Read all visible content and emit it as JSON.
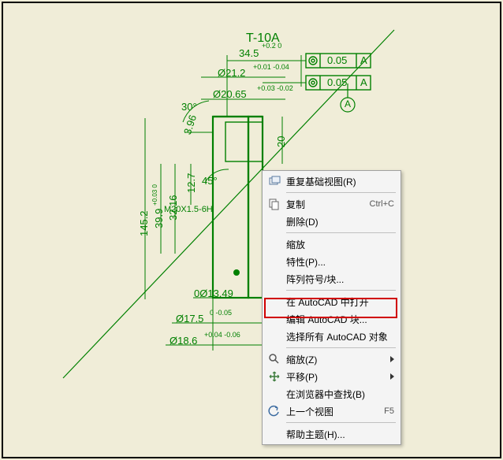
{
  "drawing": {
    "title": "T-10A",
    "dim_34_5": "34.5",
    "tol_34_5": "+0.2\n0",
    "dim_d21_2": "Ø21.2",
    "tol_d21_2": "+0.01\n-0.04",
    "dim_d20_65": "Ø20.65",
    "tol_d20_65": "+0.03\n-0.02",
    "dim_30": "30°",
    "dim_3_96": "3.96",
    "dim_20": "20",
    "dim_12_7": "12.7",
    "dim_32_16": "32.16",
    "dim_145_2": "145.2",
    "dim_39_9": "39.9",
    "tol_39_9": "+0.03\n0",
    "thread": "M20X1.5-6H",
    "dim_45": "45°",
    "dim_0_d13_49": "0Ø13.49",
    "dim_d17_5": "Ø17.5",
    "tol_d17_5": "0\n-0.05",
    "dim_d18_6": "Ø18.6",
    "tol_d18_6": "+0.04\n-0.06",
    "datum_A": "A",
    "gtol_val": "0.05",
    "gtol_ref": "A"
  },
  "menu": {
    "repeat_base": "重复基础视图(R)",
    "copy": "复制",
    "copy_shortcut": "Ctrl+C",
    "delete": "删除(D)",
    "scale": "缩放",
    "properties": "特性(P)...",
    "array_symbols": "阵列符号/块...",
    "open_in_autocad": "在 AutoCAD 中打开",
    "edit_autocad_block": "编辑 AutoCAD 块...",
    "select_all_autocad": "选择所有 AutoCAD 对象",
    "zoom": "缩放(Z)",
    "pan": "平移(P)",
    "find_in_browser": "在浏览器中查找(B)",
    "prev_view": "上一个视图",
    "prev_view_shortcut": "F5",
    "help_topic": "帮助主题(H)..."
  }
}
